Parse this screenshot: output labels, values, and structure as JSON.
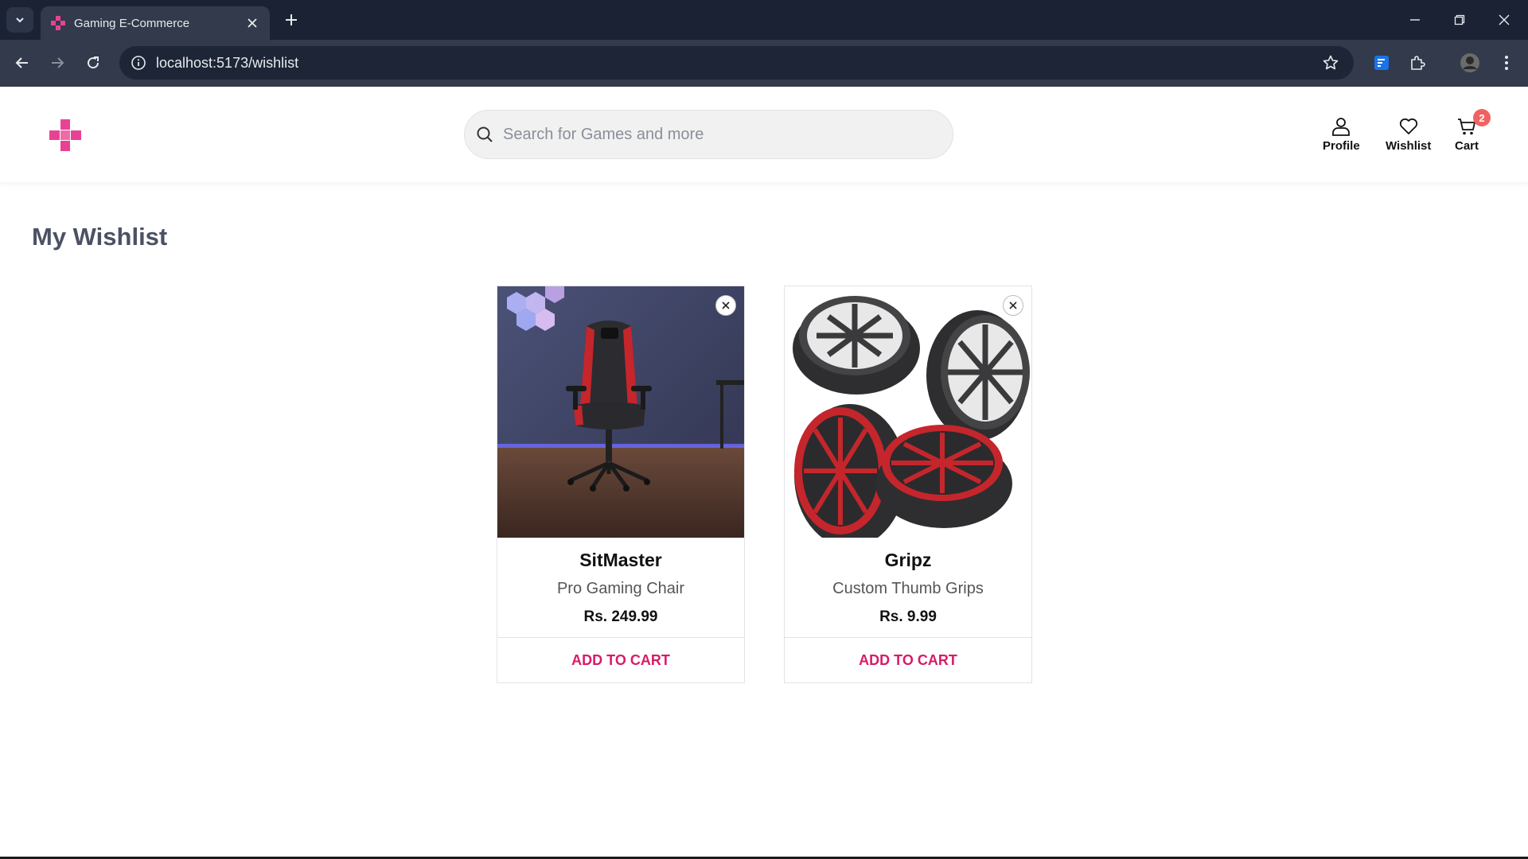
{
  "browser": {
    "tab_title": "Gaming E-Commerce",
    "url": "localhost:5173/wishlist"
  },
  "header": {
    "search_placeholder": "Search for Games and more",
    "profile_label": "Profile",
    "wishlist_label": "Wishlist",
    "cart_label": "Cart",
    "cart_count": "2"
  },
  "main": {
    "title": "My Wishlist",
    "items": [
      {
        "name": "SitMaster",
        "description": "Pro Gaming Chair",
        "price": "Rs. 249.99",
        "action": "ADD TO CART"
      },
      {
        "name": "Gripz",
        "description": "Custom Thumb Grips",
        "price": "Rs. 9.99",
        "action": "ADD TO CART"
      }
    ]
  },
  "colors": {
    "brand": "#e84393",
    "accent": "#d81b6a",
    "badge": "#f06262",
    "chrome_dark": "#1b2234"
  }
}
